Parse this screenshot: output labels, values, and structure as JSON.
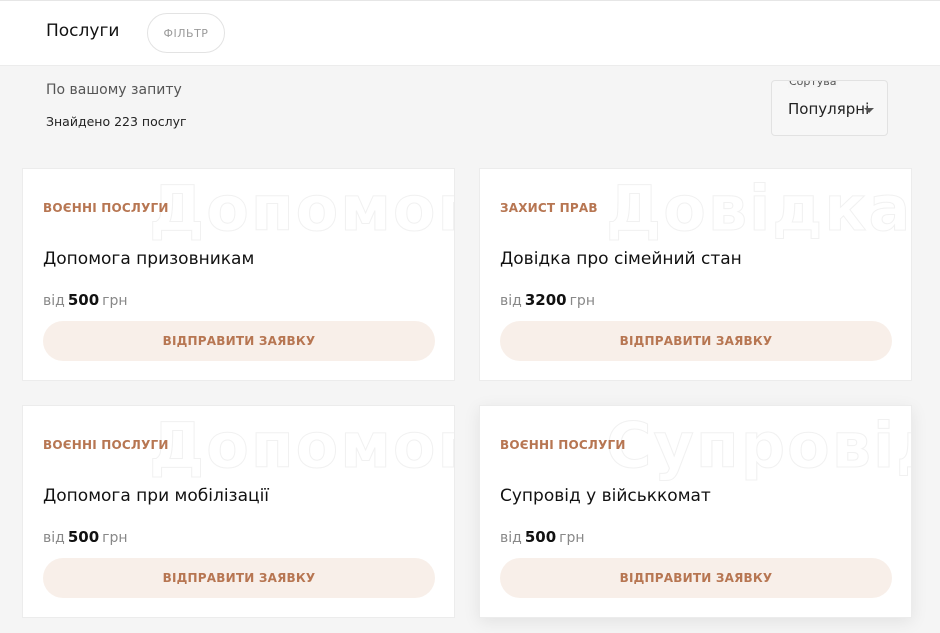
{
  "header": {
    "title": "Послуги",
    "filter_label": "ФІЛЬТР"
  },
  "results": {
    "query_label": "По вашому запиту",
    "found_label": "Знайдено 223 послуг"
  },
  "sort": {
    "label": "Сортувати",
    "value": "Популярні"
  },
  "colors": {
    "accent": "#b77652",
    "button_bg": "#f8efe9"
  },
  "cards": [
    {
      "watermark": "Допомога призовникам",
      "category": "Воєнні послуги",
      "title": "Допомога призовникам",
      "price_prefix": "від",
      "price_amount": "500",
      "price_currency": "грн",
      "button_label": "ВІДПРАВИТИ ЗАЯВКУ"
    },
    {
      "watermark": "Довідка про сімейний стан",
      "category": "Захист прав",
      "title": "Довідка про сімейний стан",
      "price_prefix": "від",
      "price_amount": "3200",
      "price_currency": "грн",
      "button_label": "ВІДПРАВИТИ ЗАЯВКУ"
    },
    {
      "watermark": "Допомога при мобілізації",
      "category": "Воєнні послуги",
      "title": "Допомога при мобілізації",
      "price_prefix": "від",
      "price_amount": "500",
      "price_currency": "грн",
      "button_label": "ВІДПРАВИТИ ЗАЯВКУ"
    },
    {
      "watermark": "Супровід у військкомат",
      "category": "Воєнні послуги",
      "title": "Супровід у військкомат",
      "price_prefix": "від",
      "price_amount": "500",
      "price_currency": "грн",
      "button_label": "ВІДПРАВИТИ ЗАЯВКУ"
    }
  ]
}
